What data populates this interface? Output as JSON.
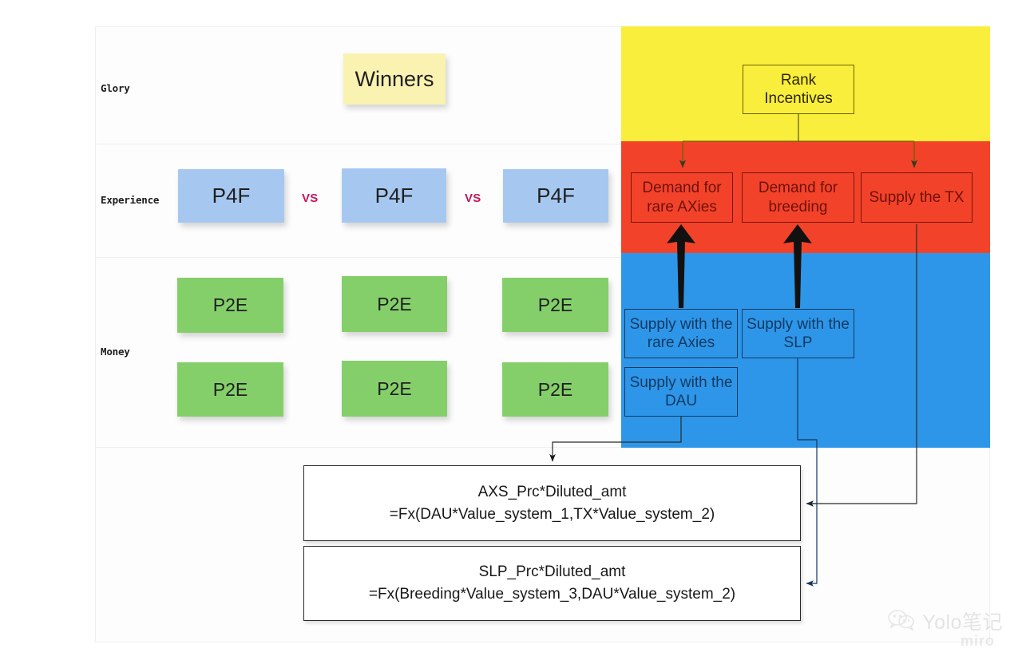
{
  "board": {
    "row_labels": [
      {
        "id": "glory",
        "text": "Glory"
      },
      {
        "id": "experience",
        "text": "Experience"
      },
      {
        "id": "money",
        "text": "Money"
      }
    ],
    "vs_label": "VS",
    "colors": {
      "yellow_band": "#faee3c",
      "red_band": "#f2432a",
      "blue_band": "#2e96e8",
      "sticky_yellow": "#faf2b0",
      "sticky_blue": "#a6c8f0",
      "sticky_green": "#84cf6a",
      "vs_text": "#c2185b"
    }
  },
  "glory_row": {
    "notes": [
      {
        "label": "Winners",
        "color": "yellow"
      }
    ]
  },
  "experience_row": {
    "notes": [
      {
        "label": "P4F",
        "color": "blue"
      },
      {
        "label": "P4F",
        "color": "blue"
      },
      {
        "label": "P4F",
        "color": "blue"
      }
    ],
    "separators": [
      "VS",
      "VS"
    ]
  },
  "money_row": {
    "notes_top": [
      {
        "label": "P2E",
        "color": "green"
      },
      {
        "label": "P2E",
        "color": "green"
      },
      {
        "label": "P2E",
        "color": "green"
      }
    ],
    "notes_bottom": [
      {
        "label": "P2E",
        "color": "green"
      },
      {
        "label": "P2E",
        "color": "green"
      },
      {
        "label": "P2E",
        "color": "green"
      }
    ]
  },
  "yellow_zone": {
    "boxes": [
      {
        "id": "rank-incentives",
        "line1": "Rank",
        "line2": "Incentives",
        "text": "Rank\nIncentives"
      }
    ]
  },
  "red_zone": {
    "boxes": [
      {
        "id": "demand-rare-axies",
        "text": "Demand for rare AXies"
      },
      {
        "id": "demand-breeding",
        "text": "Demand for breeding"
      },
      {
        "id": "supply-tx",
        "text": "Supply the TX"
      }
    ]
  },
  "blue_zone": {
    "boxes": [
      {
        "id": "supply-rare-axies",
        "text": "Supply with the rare Axies"
      },
      {
        "id": "supply-slp",
        "text": "Supply with the SLP"
      },
      {
        "id": "supply-dau",
        "text": "Supply with the DAU"
      }
    ]
  },
  "formulas": [
    {
      "id": "axs-formula",
      "line1": "AXS_Prc*Diluted_amt",
      "line2": "=Fx(DAU*Value_system_1,TX*Value_system_2)"
    },
    {
      "id": "slp-formula",
      "line1": "SLP_Prc*Diluted_amt",
      "line2": "=Fx(Breeding*Value_system_3,DAU*Value_system_2)"
    }
  ],
  "watermark": {
    "brand": "Yolo笔记",
    "tool": "miro",
    "icon": "wechat-icon"
  }
}
